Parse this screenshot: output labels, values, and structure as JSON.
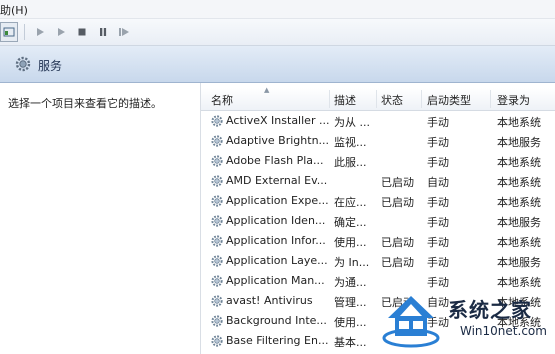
{
  "menubar": {
    "help_label": "助(H)"
  },
  "toolbar": {
    "buttons": [
      "console-tree-button",
      "play-button",
      "play-alt-button",
      "stop-button",
      "pause-button",
      "restart-button"
    ]
  },
  "header": {
    "title": "服务",
    "icon": "gear-icon"
  },
  "left_pane": {
    "description": "选择一个项目来查看它的描述。"
  },
  "table": {
    "columns": [
      "名称",
      "描述",
      "状态",
      "启动类型",
      "登录为"
    ],
    "rows": [
      {
        "name": "ActiveX Installer ...",
        "desc": "为从 ...",
        "status": "",
        "startup": "手动",
        "logon": "本地系统"
      },
      {
        "name": "Adaptive Brightn...",
        "desc": "监视...",
        "status": "",
        "startup": "手动",
        "logon": "本地服务"
      },
      {
        "name": "Adobe Flash Pla...",
        "desc": "此服...",
        "status": "",
        "startup": "手动",
        "logon": "本地系统"
      },
      {
        "name": "AMD External Ev...",
        "desc": "",
        "status": "已启动",
        "startup": "自动",
        "logon": "本地系统"
      },
      {
        "name": "Application Expe...",
        "desc": "在应...",
        "status": "已启动",
        "startup": "手动",
        "logon": "本地系统"
      },
      {
        "name": "Application Iden...",
        "desc": "确定...",
        "status": "",
        "startup": "手动",
        "logon": "本地服务"
      },
      {
        "name": "Application Infor...",
        "desc": "使用...",
        "status": "已启动",
        "startup": "手动",
        "logon": "本地系统"
      },
      {
        "name": "Application Laye...",
        "desc": "为 In...",
        "status": "已启动",
        "startup": "手动",
        "logon": "本地服务"
      },
      {
        "name": "Application Man...",
        "desc": "为通...",
        "status": "",
        "startup": "手动",
        "logon": "本地系统"
      },
      {
        "name": "avast! Antivirus",
        "desc": "管理...",
        "status": "已启动",
        "startup": "自动",
        "logon": "本地系统"
      },
      {
        "name": "Background Inte...",
        "desc": "使用...",
        "status": "",
        "startup": "手动",
        "logon": "本地系统"
      },
      {
        "name": "Base Filtering En...",
        "desc": "基本...",
        "status": "",
        "startup": "",
        "logon": ""
      }
    ]
  },
  "watermark": {
    "line1": "系统之家",
    "line2": "Win10net.com"
  },
  "colors": {
    "header_bg": "#c8d8ec",
    "accent": "#1e3050",
    "watermark_blue": "#2a7fd4"
  }
}
